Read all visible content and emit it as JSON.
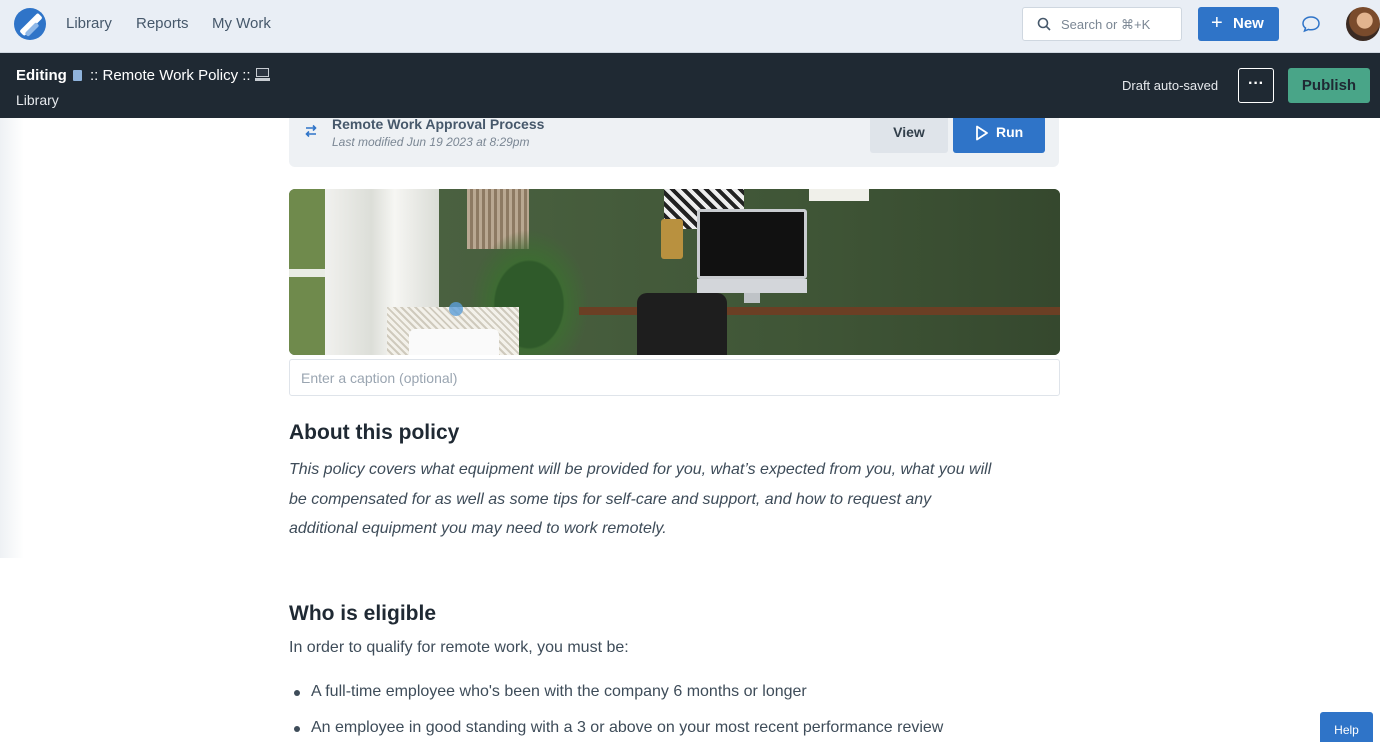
{
  "nav": {
    "links": [
      "Library",
      "Reports",
      "My Work"
    ],
    "search_placeholder": "Search or ⌘+K",
    "new_label": "New"
  },
  "editbar": {
    "mode": "Editing",
    "title": ":: Remote Work Policy ::",
    "breadcrumb": "Library",
    "autosave": "Draft auto-saved",
    "more_label": "···",
    "publish_label": "Publish"
  },
  "workflow": {
    "title": "Remote Work Approval Process",
    "modified": "Last modified Jun 19 2023 at 8:29pm",
    "view_label": "View",
    "run_label": "Run"
  },
  "caption": {
    "placeholder": "Enter a caption (optional)"
  },
  "about": {
    "heading": "About this policy",
    "lines": [
      "This policy covers what equipment will be provided for you, what’s expected from you, what you will",
      "be compensated for as well as some tips for self-care and support, and how to request any",
      "additional equipment you may need to work remotely."
    ]
  },
  "eligible": {
    "heading": "Who is eligible",
    "intro": "In order to qualify for remote work, you must be:",
    "bullets": [
      "A full-time employee who's been with the company 6 months or longer",
      "An employee in good standing with a 3 or above on your most recent performance review"
    ]
  },
  "help_label": "Help",
  "colors": {
    "primary": "#2f74c8",
    "publish": "#49a588",
    "editbar": "#1f2933"
  }
}
